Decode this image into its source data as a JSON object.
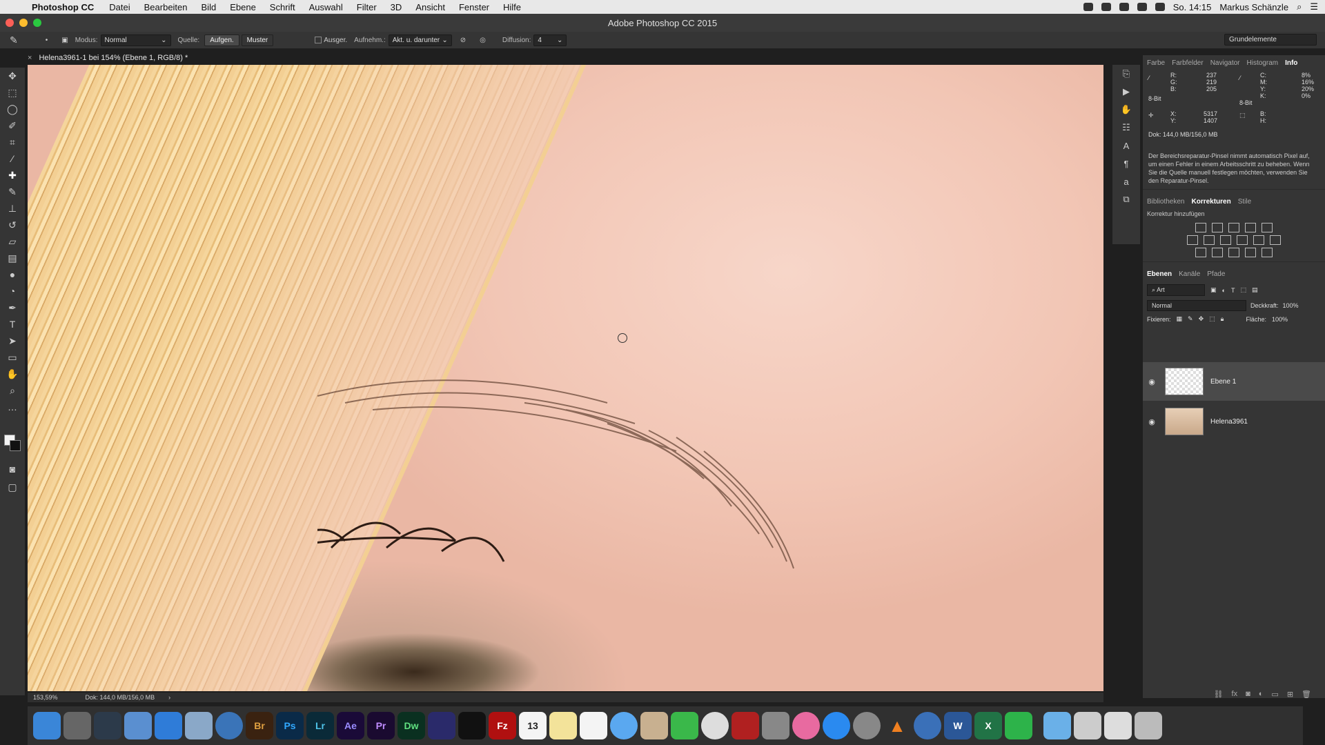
{
  "menubar": {
    "app": "Photoshop CC",
    "items": [
      "Datei",
      "Bearbeiten",
      "Bild",
      "Ebene",
      "Schrift",
      "Auswahl",
      "Filter",
      "3D",
      "Ansicht",
      "Fenster",
      "Hilfe"
    ],
    "clock": "So. 14:15",
    "user": "Markus Schänzle"
  },
  "window": {
    "title": "Adobe Photoshop CC 2015"
  },
  "options": {
    "modus_label": "Modus:",
    "modus_value": "Normal",
    "quelle_label": "Quelle:",
    "quelle_a": "Aufgen.",
    "quelle_b": "Muster",
    "ausger_label": "Ausger.",
    "aufnehm_label": "Aufnehm.:",
    "aufnehm_value": "Akt. u. darunter",
    "diffusion_label": "Diffusion:",
    "diffusion_value": "4",
    "workspace": "Grundelemente"
  },
  "document": {
    "tab": "Helena3961-1 bei 154% (Ebene 1, RGB/8) *"
  },
  "info_panel": {
    "tabs": [
      "Farbe",
      "Farbfelder",
      "Navigator",
      "Histogram",
      "Info"
    ],
    "r_label": "R:",
    "g_label": "G:",
    "b_label": "B:",
    "r": "237",
    "g": "219",
    "b": "205",
    "bit_left": "8-Bit",
    "bit_right": "8-Bit",
    "c_label": "C:",
    "m_label": "M:",
    "y_label": "Y:",
    "k_label": "K:",
    "c": "8%",
    "m": "16%",
    "y": "20%",
    "k": "0%",
    "x_label": "X:",
    "y2_label": "Y:",
    "x": "5317",
    "y2": "1407",
    "w_label": "B:",
    "h_label": "H:",
    "doc": "Dok: 144,0 MB/156,0 MB",
    "hint": "Der Bereichsreparatur-Pinsel nimmt automatisch Pixel auf, um einen Fehler in einem Arbeitsschritt zu beheben. Wenn Sie die Quelle manuell festlegen möchten, verwenden Sie den Reparatur-Pinsel."
  },
  "corrections_panel": {
    "tabs": [
      "Bibliotheken",
      "Korrekturen",
      "Stile"
    ],
    "subtitle": "Korrektur hinzufügen"
  },
  "layers_panel": {
    "tabs": [
      "Ebenen",
      "Kanäle",
      "Pfade"
    ],
    "filter": "Art",
    "blend": "Normal",
    "opacity_label": "Deckkraft:",
    "opacity": "100%",
    "lock_label": "Fixieren:",
    "fill_label": "Fläche:",
    "fill": "100%",
    "layers": [
      {
        "name": "Ebene 1"
      },
      {
        "name": "Helena3961"
      }
    ]
  },
  "status": {
    "zoom": "153,59%",
    "doc": "Dok: 144,0 MB/156,0 MB"
  },
  "dock": [
    "Finder",
    "Launchpad",
    "Mission",
    "Mail",
    "Safari",
    "Vorschau",
    "1Password",
    "Br",
    "Ps",
    "Lr",
    "Ae",
    "Pr",
    "Dw",
    "Ctrl",
    "Terminal",
    "FileZilla",
    "13",
    "Notes",
    "Erinnerungen",
    "Nachrichten",
    "Kontakte",
    "FaceTime",
    "Fotos",
    "Photo Booth",
    "Skripts",
    "iTunes",
    "App Store",
    "Systemeinstellungen",
    "VLC",
    "Chrome",
    "W",
    "X",
    "Evernote",
    "Ordner",
    "Brushes",
    "Downloads",
    "Papierkorb"
  ],
  "colors": {
    "accent": "#3c6ea6",
    "panel": "#353535",
    "skin": "#f2c6b5",
    "hair": "#f5d59c"
  }
}
